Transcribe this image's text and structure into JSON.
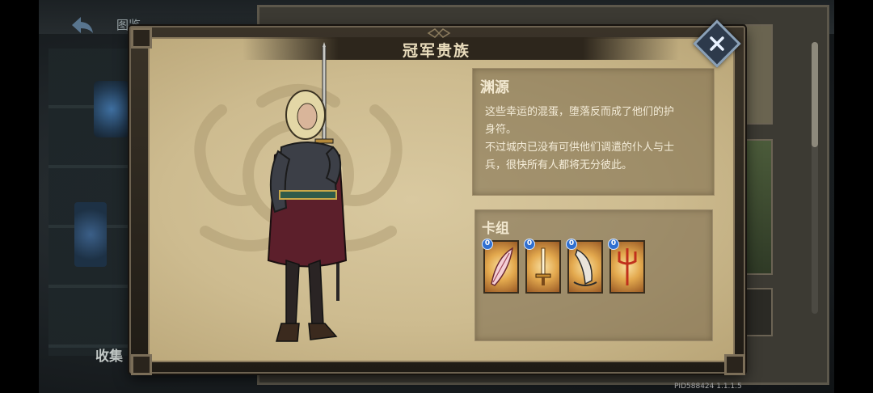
{
  "background": {
    "screen_title": "图鉴",
    "collect_label": "收集",
    "version_text": "PID588424  1.1.1.5"
  },
  "dialog": {
    "title": "冠军贵族",
    "lore": {
      "heading": "渊源",
      "lines": [
        "这些幸运的混蛋，堕落反而成了他们的护",
        "身符。",
        "不过城内已没有可供他们调遣的仆人与士",
        "兵，很快所有人都将无分彼此。"
      ]
    },
    "deck": {
      "heading": "卡组",
      "cards": [
        {
          "cost": "0",
          "icon": "feather-blade-icon"
        },
        {
          "cost": "0",
          "icon": "sword-icon"
        },
        {
          "cost": "0",
          "icon": "horn-icon"
        },
        {
          "cost": "0",
          "icon": "trident-icon"
        }
      ]
    }
  },
  "colors": {
    "parchment": "#cdbb8f",
    "frame": "#2d261c",
    "close_button": "#2d3a4b",
    "cost_badge": "#2f6fd0"
  }
}
